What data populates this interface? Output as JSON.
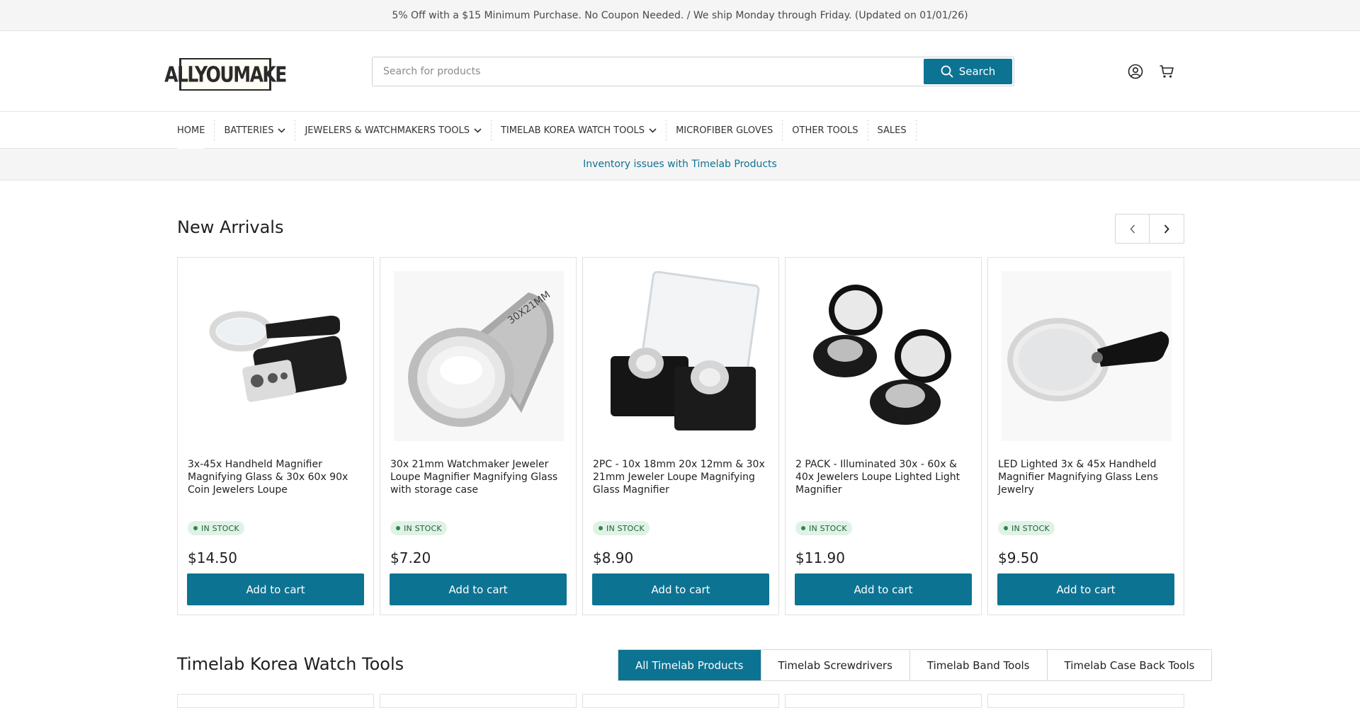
{
  "announcement": {
    "text": "5% Off with a $15 Minimum Purchase. No Coupon Needed. / We ship Monday through Friday. (Updated on 01/01/26)"
  },
  "header": {
    "logo_text": "ALLYOUMAKE",
    "search": {
      "placeholder": "Search for products",
      "value": "",
      "button_label": "Search"
    },
    "icons": [
      "account-icon",
      "cart-icon"
    ]
  },
  "nav": {
    "items": [
      {
        "label": "HOME",
        "dropdown": false
      },
      {
        "label": "BATTERIES",
        "dropdown": true
      },
      {
        "label": "JEWELERS & WATCHMAKERS TOOLS",
        "dropdown": true
      },
      {
        "label": "TIMELAB KOREA WATCH TOOLS",
        "dropdown": true
      },
      {
        "label": "MICROFIBER GLOVES",
        "dropdown": false
      },
      {
        "label": "OTHER TOOLS",
        "dropdown": false
      },
      {
        "label": "SALES",
        "dropdown": false
      }
    ]
  },
  "notice": {
    "text": "Inventory issues with Timelab Products"
  },
  "new_arrivals": {
    "title": "New Arrivals",
    "products": [
      {
        "title": "3x-45x Handheld Magnifier Magnifying Glass & 30x 60x 90x Coin Jewelers Loupe",
        "stock": "IN STOCK",
        "price": "$14.50",
        "button": "Add to cart",
        "image": "handheld-magnifier-with-pocket-loupe"
      },
      {
        "title": "30x 21mm Watchmaker Jeweler Loupe Magnifier Magnifying Glass with storage case",
        "stock": "IN STOCK",
        "price": "$7.20",
        "button": "Add to cart",
        "image": "chrome-jeweler-loupe-30x21mm"
      },
      {
        "title": "2PC - 10x 18mm 20x 12mm & 30x 21mm Jeweler Loupe Magnifying Glass Magnifier",
        "stock": "IN STOCK",
        "price": "$8.90",
        "button": "Add to cart",
        "image": "two-loupes-in-cases"
      },
      {
        "title": "2 PACK - Illuminated 30x - 60x & 40x Jewelers Loupe Lighted Light Magnifier",
        "stock": "IN STOCK",
        "price": "$11.90",
        "button": "Add to cart",
        "image": "two-illuminated-loupes"
      },
      {
        "title": "LED Lighted 3x & 45x Handheld Magnifier Magnifying Glass Lens Jewelry",
        "stock": "IN STOCK",
        "price": "$9.50",
        "button": "Add to cart",
        "image": "led-handheld-magnifier"
      }
    ]
  },
  "timelab": {
    "title": "Timelab Korea Watch Tools",
    "tabs": [
      {
        "label": "All Timelab Products",
        "active": true
      },
      {
        "label": "Timelab Screwdrivers",
        "active": false
      },
      {
        "label": "Timelab Band Tools",
        "active": false
      },
      {
        "label": "Timelab Case Back Tools",
        "active": false
      }
    ]
  },
  "colors": {
    "accent": "#0d7393",
    "stock_bg": "#e0f2e6",
    "stock_text": "#1f5f37"
  }
}
